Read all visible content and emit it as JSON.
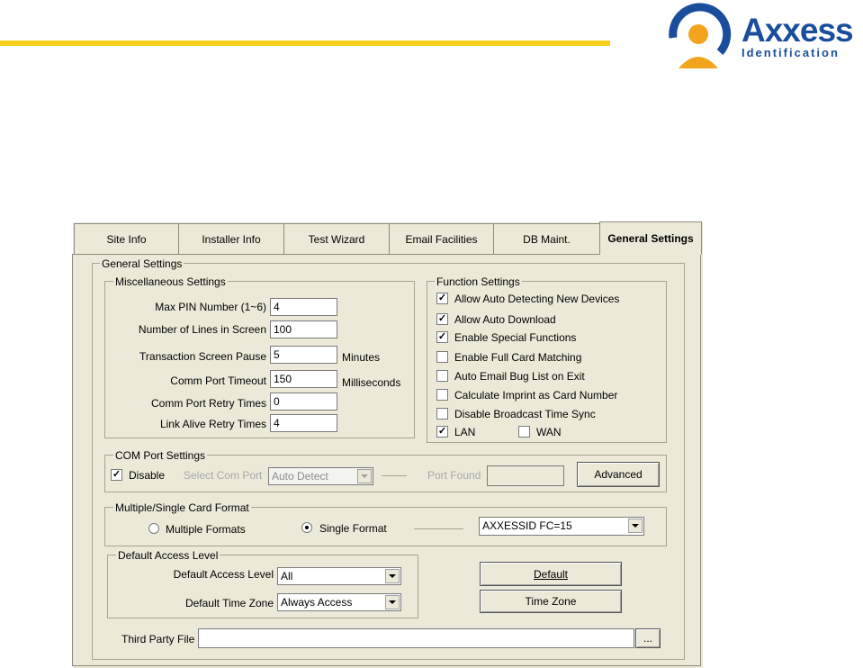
{
  "brand": {
    "name": "Axxess",
    "tagline": "Identification"
  },
  "colors": {
    "accent_line": "#f5d21b",
    "brand_blue": "#1a4e9c",
    "brand_orange": "#f2a51c"
  },
  "tabs": [
    {
      "label": "Site Info",
      "active": false
    },
    {
      "label": "Installer Info",
      "active": false
    },
    {
      "label": "Test Wizard",
      "active": false
    },
    {
      "label": "Email Facilities",
      "active": false
    },
    {
      "label": "DB Maint.",
      "active": false
    },
    {
      "label": "General Settings",
      "active": true
    }
  ],
  "general": {
    "title": "General Settings"
  },
  "misc": {
    "title": "Miscellaneous Settings",
    "max_pin": {
      "label": "Max PIN Number (1~6)",
      "value": "4"
    },
    "lines": {
      "label": "Number of Lines in Screen",
      "value": "100"
    },
    "pause": {
      "label": "Transaction Screen Pause",
      "value": "5",
      "unit": "Minutes"
    },
    "timeout": {
      "label": "Comm Port Timeout",
      "value": "150",
      "unit": "Milliseconds"
    },
    "retry": {
      "label": "Comm Port Retry Times",
      "value": "0"
    },
    "alive": {
      "label": "Link Alive Retry Times",
      "value": "4"
    }
  },
  "functions": {
    "title": "Function Settings",
    "items": [
      {
        "label": "Allow Auto Detecting New Devices",
        "checked": true
      },
      {
        "label": "Allow Auto Download",
        "checked": true
      },
      {
        "label": "Enable Special Functions",
        "checked": true
      },
      {
        "label": "Enable Full Card Matching",
        "checked": false
      },
      {
        "label": "Auto Email Bug List on Exit",
        "checked": false
      },
      {
        "label": "Calculate Imprint as Card Number",
        "checked": false
      },
      {
        "label": "Disable Broadcast Time Sync",
        "checked": false
      }
    ],
    "lan": {
      "label": "LAN",
      "checked": true
    },
    "wan": {
      "label": "WAN",
      "checked": false
    }
  },
  "com": {
    "title": "COM Port Settings",
    "disable": {
      "label": "Disable",
      "checked": true
    },
    "select_label": "Select Com Port",
    "select_value": "Auto Detect",
    "port_found_label": "Port Found",
    "port_found_value": "",
    "advanced_label": "Advanced"
  },
  "format": {
    "title": "Multiple/Single Card Format",
    "multiple": {
      "label": "Multiple Formats",
      "selected": false
    },
    "single": {
      "label": "Single Format",
      "selected": true
    },
    "value": "AXXESSID FC=15"
  },
  "access": {
    "title": "Default Access Level",
    "level": {
      "label": "Default Access Level",
      "value": "All"
    },
    "zone": {
      "label": "Default Time Zone",
      "value": "Always Access"
    },
    "default_btn": "Default",
    "timezone_btn": "Time Zone"
  },
  "third_party": {
    "label": "Third Party File",
    "value": "",
    "browse": "..."
  }
}
